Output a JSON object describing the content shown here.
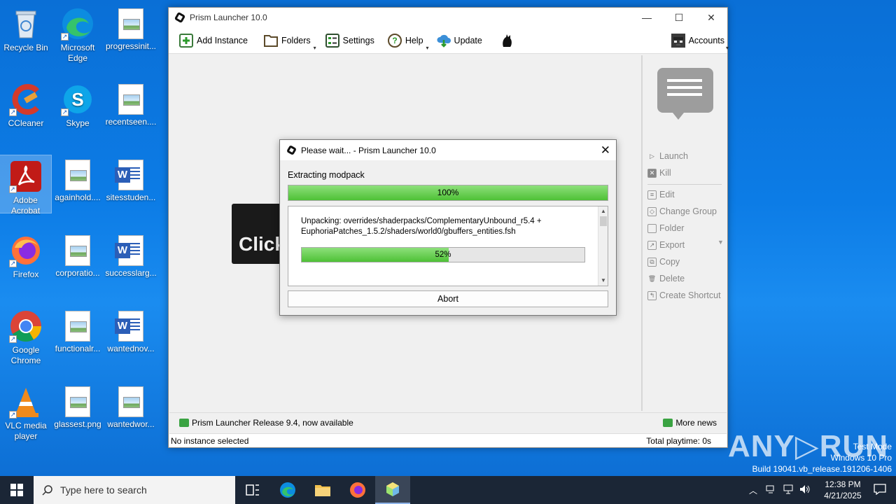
{
  "desktop": {
    "icons": [
      {
        "label": "Recycle Bin"
      },
      {
        "label": "Microsoft Edge"
      },
      {
        "label": "progressinit..."
      },
      {
        "label": "CCleaner"
      },
      {
        "label": "Skype"
      },
      {
        "label": "recentseen...."
      },
      {
        "label": "Adobe Acrobat"
      },
      {
        "label": "againhold...."
      },
      {
        "label": "sitesstuden..."
      },
      {
        "label": "Firefox"
      },
      {
        "label": "corporatio..."
      },
      {
        "label": "successlarg..."
      },
      {
        "label": "Google Chrome"
      },
      {
        "label": "functionalr..."
      },
      {
        "label": "wantednov..."
      },
      {
        "label": "VLC media player"
      },
      {
        "label": "glassest.png"
      },
      {
        "label": "wantedwor..."
      }
    ]
  },
  "window": {
    "title": "Prism Launcher 10.0",
    "toolbar": {
      "add_instance": "Add Instance",
      "folders": "Folders",
      "settings": "Settings",
      "help": "Help",
      "update": "Update",
      "accounts": "Accounts"
    },
    "content_button": "Click",
    "side": {
      "launch": "Launch",
      "kill": "Kill",
      "edit": "Edit",
      "change_group": "Change Group",
      "folder": "Folder",
      "export": "Export",
      "copy": "Copy",
      "delete": "Delete",
      "create_shortcut": "Create Shortcut"
    },
    "news": "Prism Launcher Release 9.4, now available",
    "more_news": "More news",
    "status_left": "No instance selected",
    "status_right": "Total playtime: 0s"
  },
  "dialog": {
    "title": "Please wait... - Prism Launcher 10.0",
    "label": "Extracting modpack",
    "main_progress": 100,
    "main_progress_text": "100%",
    "detail_text": "Unpacking: overrides/shaderpacks/ComplementaryUnbound_r5.4 + EuphoriaPatches_1.5.2/shaders/world0/gbuffers_entities.fsh",
    "sub_progress": 52,
    "sub_progress_text": "52%",
    "abort": "Abort"
  },
  "taskbar": {
    "search_placeholder": "Type here to search",
    "time": "12:38 PM",
    "date": "4/21/2025"
  },
  "watermark": {
    "line1": "Test Mode",
    "line2": "Windows 10 Pro",
    "line3": "Build 19041.vb_release.191206-1406",
    "brand": "ANY RUN"
  }
}
